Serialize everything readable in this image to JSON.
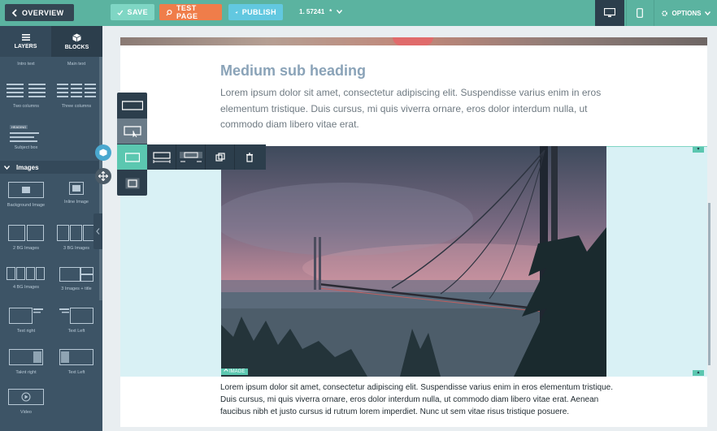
{
  "topbar": {
    "overview_label": "OVERVIEW",
    "save_label": "SAVE",
    "test_label": "TEST PAGE",
    "publish_label": "PUBLISH",
    "version": "1. 57241",
    "version_flag": "*",
    "options_label": "OPTIONS"
  },
  "sidebar": {
    "tabs": [
      {
        "label": "LAYERS",
        "icon": "layers-icon"
      },
      {
        "label": "BLOCKS",
        "icon": "blocks-icon"
      }
    ],
    "text_items": [
      {
        "label": "Intro text"
      },
      {
        "label": "Main text"
      },
      {
        "label": "Two columns"
      },
      {
        "label": "Three columns"
      },
      {
        "label": "Subject box",
        "thumb_text": "HEADING"
      }
    ],
    "section_title": "Images",
    "image_items": [
      {
        "label": "Background Image"
      },
      {
        "label": "Inline Image"
      },
      {
        "label": "2 BG Images"
      },
      {
        "label": "3 BG Images"
      },
      {
        "label": "4 BG Images"
      },
      {
        "label": "3 Images + title"
      },
      {
        "label": "Text right"
      },
      {
        "label": "Text Left"
      },
      {
        "label": "Taknt right"
      },
      {
        "label": "Text Left"
      },
      {
        "label": "Video"
      }
    ]
  },
  "canvas": {
    "heading": "Medium sub heading",
    "paragraph": "Lorem ipsum dolor sit amet, consectetur adipiscing elit. Suspendisse varius enim in eros elementum tristique. Duis cursus, mi quis viverra ornare, eros dolor interdum nulla, ut commodo diam libero vitae erat.",
    "image_label": "IMAGE",
    "paragraph2": "Lorem ipsum dolor sit amet, consectetur adipiscing elit. Suspendisse varius enim in eros elementum tristique. Duis cursus, mi quis viverra ornare, eros dolor interdum nulla, ut commodo diam libero vitae erat. Aenean faucibus nibh et justo cursus id rutrum lorem imperdiet. Nunc ut sem vitae risus tristique posuere."
  },
  "colors": {
    "topbar": "#5bb3a0",
    "sidebar": "#3d5466",
    "accent": "#5bc7b0",
    "test_button": "#ef7d4a",
    "publish_button": "#62c8e0",
    "image_band": "#d9f1f5"
  }
}
